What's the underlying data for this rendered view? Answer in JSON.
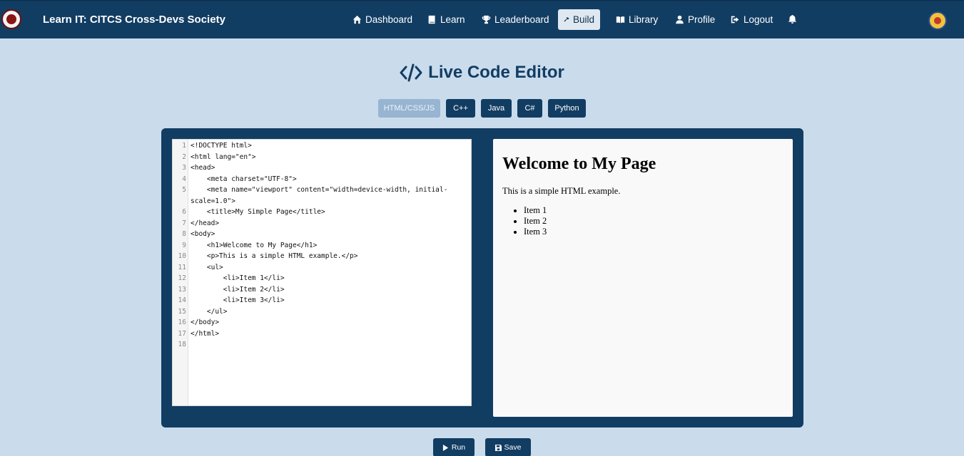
{
  "navbar": {
    "brand": "Learn IT: CITCS Cross-Devs Society",
    "items": [
      {
        "label": "Dashboard",
        "icon": "home-icon"
      },
      {
        "label": "Learn",
        "icon": "book-icon"
      },
      {
        "label": "Leaderboard",
        "icon": "trophy-icon"
      },
      {
        "label": "Build",
        "icon": "hammer-icon",
        "active": true
      },
      {
        "label": "Library",
        "icon": "open-book-icon"
      },
      {
        "label": "Profile",
        "icon": "user-icon"
      },
      {
        "label": "Logout",
        "icon": "sign-out-icon"
      }
    ],
    "notification_icon": "bell-icon"
  },
  "page": {
    "title": "Live Code Editor",
    "title_icon": "code-icon"
  },
  "tabs": [
    {
      "label": "HTML/CSS/JS",
      "active": true
    },
    {
      "label": "C++"
    },
    {
      "label": "Java"
    },
    {
      "label": "C#"
    },
    {
      "label": "Python"
    }
  ],
  "editor": {
    "lines": [
      {
        "num": "1",
        "text": "<!DOCTYPE html>"
      },
      {
        "num": "2",
        "text": "<html lang=\"en\">"
      },
      {
        "num": "3",
        "text": "<head>"
      },
      {
        "num": "4",
        "text": "    <meta charset=\"UTF-8\">"
      },
      {
        "num": "5",
        "text": "    <meta name=\"viewport\" content=\"width=device-width, initial-"
      },
      {
        "num": "",
        "text": "scale=1.0\">"
      },
      {
        "num": "6",
        "text": "    <title>My Simple Page</title>"
      },
      {
        "num": "7",
        "text": "</head>"
      },
      {
        "num": "8",
        "text": "<body>"
      },
      {
        "num": "9",
        "text": "    <h1>Welcome to My Page</h1>"
      },
      {
        "num": "10",
        "text": "    <p>This is a simple HTML example.</p>"
      },
      {
        "num": "11",
        "text": "    <ul>"
      },
      {
        "num": "12",
        "text": "        <li>Item 1</li>"
      },
      {
        "num": "13",
        "text": "        <li>Item 2</li>"
      },
      {
        "num": "14",
        "text": "        <li>Item 3</li>"
      },
      {
        "num": "15",
        "text": "    </ul>"
      },
      {
        "num": "16",
        "text": "</body>"
      },
      {
        "num": "17",
        "text": "</html>"
      },
      {
        "num": "18",
        "text": ""
      }
    ]
  },
  "preview": {
    "heading": "Welcome to My Page",
    "paragraph": "This is a simple HTML example.",
    "items": [
      "Item 1",
      "Item 2",
      "Item 3"
    ]
  },
  "actions": {
    "run_label": "Run",
    "save_label": "Save"
  },
  "colors": {
    "navbar_bg": "#123d63",
    "page_bg": "#cadcec",
    "accent": "#123d63",
    "active_tab": "#97b4d1"
  }
}
